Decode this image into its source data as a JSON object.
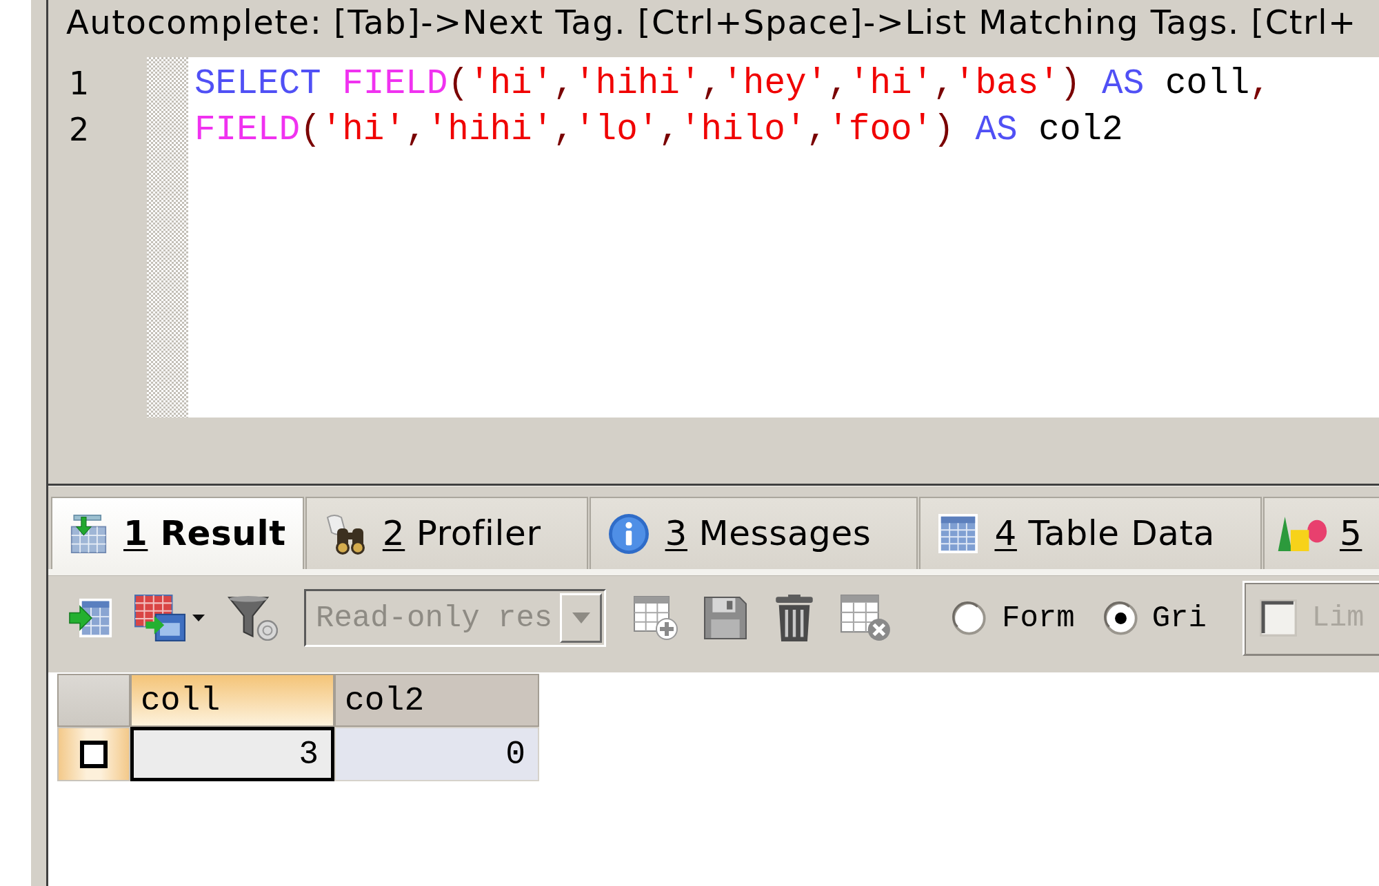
{
  "hint_bar": {
    "text": "Autocomplete: [Tab]->Next Tag. [Ctrl+Space]->List Matching Tags. [Ctrl+"
  },
  "editor": {
    "lines": [
      {
        "number": "1",
        "tokens": [
          {
            "kind": "keyword",
            "text": "SELECT "
          },
          {
            "kind": "function",
            "text": "FIELD"
          },
          {
            "kind": "punct",
            "text": "("
          },
          {
            "kind": "string",
            "text": "'hi'"
          },
          {
            "kind": "punct",
            "text": ","
          },
          {
            "kind": "string",
            "text": "'hihi'"
          },
          {
            "kind": "punct",
            "text": ","
          },
          {
            "kind": "string",
            "text": "'hey'"
          },
          {
            "kind": "punct",
            "text": ","
          },
          {
            "kind": "string",
            "text": "'hi'"
          },
          {
            "kind": "punct",
            "text": ","
          },
          {
            "kind": "string",
            "text": "'bas'"
          },
          {
            "kind": "punct",
            "text": ") "
          },
          {
            "kind": "keyword",
            "text": "AS"
          },
          {
            "kind": "plain",
            "text": " coll"
          },
          {
            "kind": "punct",
            "text": ","
          }
        ]
      },
      {
        "number": "2",
        "tokens": [
          {
            "kind": "function",
            "text": "FIELD"
          },
          {
            "kind": "punct",
            "text": "("
          },
          {
            "kind": "string",
            "text": "'hi'"
          },
          {
            "kind": "punct",
            "text": ","
          },
          {
            "kind": "string",
            "text": "'hihi'"
          },
          {
            "kind": "punct",
            "text": ","
          },
          {
            "kind": "string",
            "text": "'lo'"
          },
          {
            "kind": "punct",
            "text": ","
          },
          {
            "kind": "string",
            "text": "'hilo'"
          },
          {
            "kind": "punct",
            "text": ","
          },
          {
            "kind": "string",
            "text": "'foo'"
          },
          {
            "kind": "punct",
            "text": ") "
          },
          {
            "kind": "keyword",
            "text": "AS"
          },
          {
            "kind": "plain",
            "text": " col2"
          }
        ]
      }
    ]
  },
  "result_tabs": [
    {
      "number": "1",
      "label": "Result",
      "selected": true
    },
    {
      "number": "2",
      "label": "Profiler",
      "selected": false
    },
    {
      "number": "3",
      "label": "Messages",
      "selected": false
    },
    {
      "number": "4",
      "label": "Table Data",
      "selected": false
    },
    {
      "number": "5",
      "selected": false
    }
  ],
  "toolbar": {
    "mode_dropdown": {
      "value": "Read-only res",
      "disabled": true
    },
    "view_options": [
      {
        "label": "Form",
        "selected": false
      },
      {
        "label": "Gri",
        "selected": true
      }
    ],
    "limit_option": {
      "label": "Lim",
      "checked": false,
      "disabled": true
    }
  },
  "grid": {
    "columns": [
      {
        "label": "coll",
        "selected": true
      },
      {
        "label": "col2",
        "selected": false
      }
    ],
    "rows": [
      {
        "selected": true,
        "checked": false,
        "cells": [
          {
            "text": "3",
            "focused": true
          },
          {
            "text": "0",
            "focused": false
          }
        ]
      }
    ]
  }
}
